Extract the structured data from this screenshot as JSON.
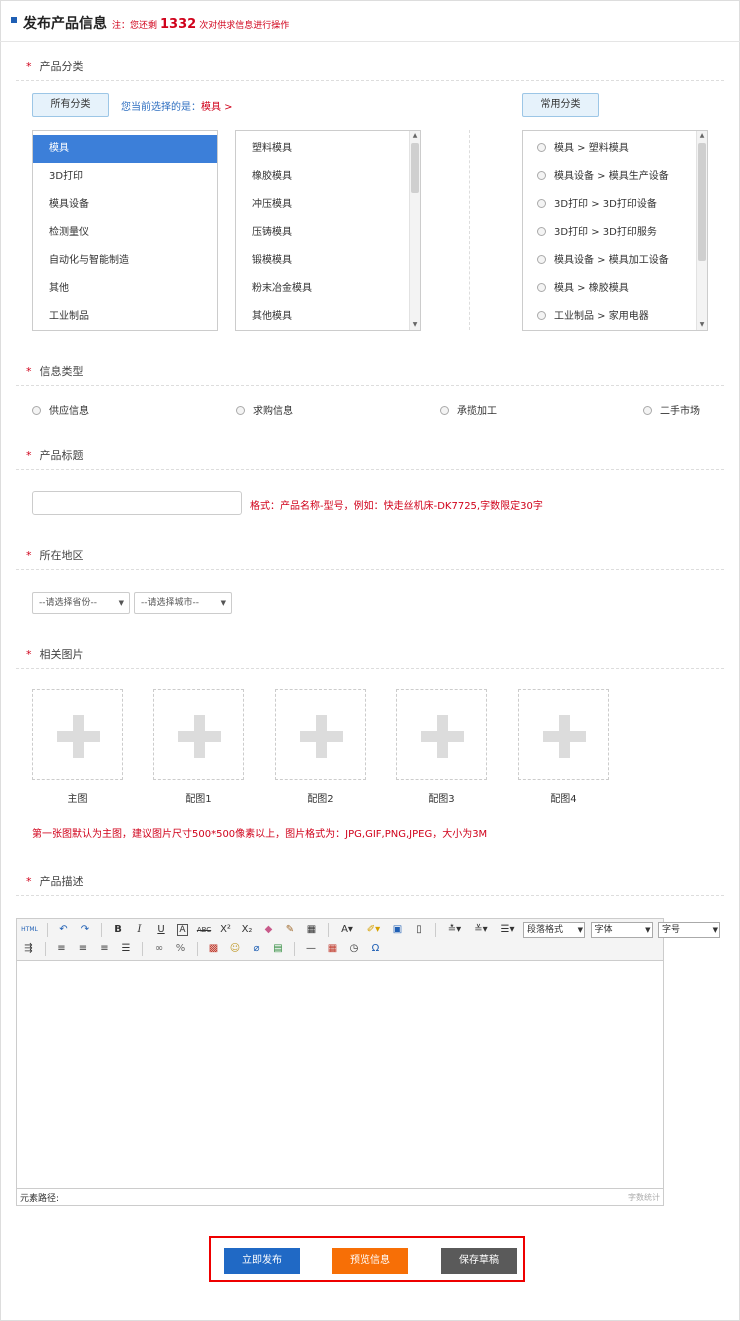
{
  "header": {
    "title": "发布产品信息",
    "note_prefix": "注：您还剩",
    "note_count": "1332",
    "note_suffix": "次对供求信息进行操作"
  },
  "category": {
    "label": "产品分类",
    "all_tab": "所有分类",
    "current_prefix": "您当前选择的是：",
    "current_value": "模具 >",
    "common_tab": "常用分类",
    "level1": [
      "模具",
      "3D打印",
      "模具设备",
      "检测量仪",
      "自动化与智能制造",
      "其他",
      "工业制品"
    ],
    "level2": [
      "塑料模具",
      "橡胶模具",
      "冲压模具",
      "压铸模具",
      "锻模模具",
      "粉末冶金模具",
      "其他模具"
    ],
    "common": [
      "模具 > 塑料模具",
      "模具设备 > 模具生产设备",
      "3D打印 > 3D打印设备",
      "3D打印 > 3D打印服务",
      "模具设备 > 模具加工设备",
      "模具 > 橡胶模具",
      "工业制品 > 家用电器"
    ]
  },
  "info_type": {
    "label": "信息类型",
    "options": [
      "供应信息",
      "求购信息",
      "承揽加工",
      "二手市场"
    ]
  },
  "title_field": {
    "label": "产品标题",
    "value": "",
    "hint": "格式：产品名称-型号，例如：快走丝机床-DK7725,字数限定30字"
  },
  "region": {
    "label": "所在地区",
    "province": "--请选择省份--",
    "city": "--请选择城市--"
  },
  "images": {
    "label": "相关图片",
    "slots": [
      "主图",
      "配图1",
      "配图2",
      "配图3",
      "配图4"
    ],
    "hint": "第一张图默认为主图，建议图片尺寸500*500像素以上，图片格式为：JPG,GIF,PNG,JPEG，大小为3M"
  },
  "description": {
    "label": "产品描述",
    "toolbar": {
      "html": "HTML",
      "paragraph": "段落格式",
      "font": "字体",
      "size": "字号"
    },
    "path_label": "元素路径:",
    "word_count": "字数统计"
  },
  "actions": {
    "publish": "立即发布",
    "preview": "预览信息",
    "draft": "保存草稿"
  },
  "colors": {
    "publish": "#2069c5",
    "preview": "#f76f06",
    "draft": "#5a5a5a",
    "required": "#d0021b",
    "selected": "#3c7fd9"
  }
}
